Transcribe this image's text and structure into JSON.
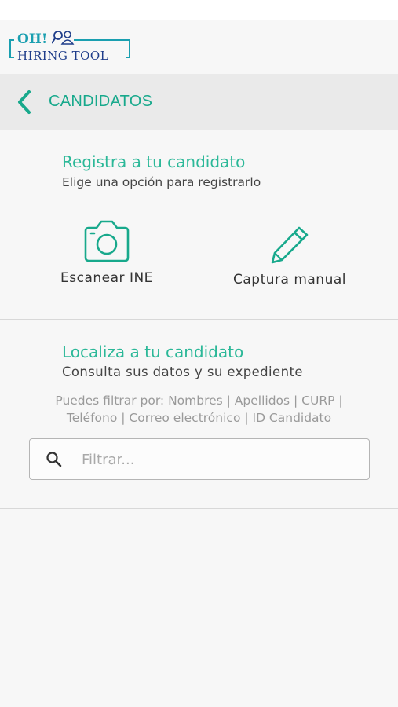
{
  "logo": {
    "line1": "OH!",
    "line2": "HIRING  TOOL"
  },
  "header": {
    "title": "CANDIDATOS"
  },
  "register": {
    "title": "Registra a tu candidato",
    "subtitle": "Elige una opción para registrarlo",
    "options": [
      {
        "label": "Escanear INE",
        "icon": "camera-icon"
      },
      {
        "label": "Captura manual",
        "icon": "pencil-icon"
      }
    ]
  },
  "locate": {
    "title": "Localiza a tu candidato",
    "subtitle": "Consulta sus datos y su expediente",
    "hint_line1": "Puedes filtrar por: Nombres | Apellidos | CURP |",
    "hint_line2": "Teléfono | Correo electrónico | ID Candidato"
  },
  "search": {
    "placeholder": "Filtrar...",
    "value": "",
    "icon": "search-icon"
  },
  "colors": {
    "accent": "#18a98c",
    "header_bg": "#eaeaea",
    "logo_blue": "#1f3d8a",
    "logo_teal": "#1a9fb0"
  }
}
